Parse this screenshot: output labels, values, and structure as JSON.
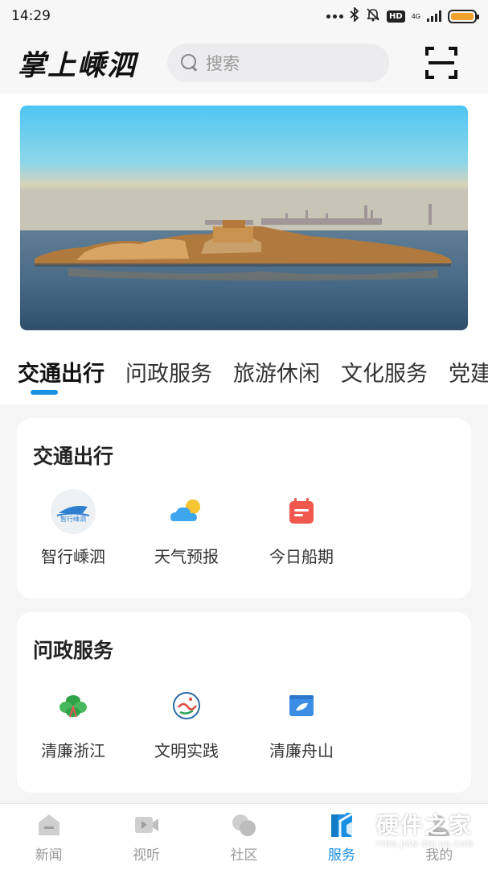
{
  "status_bar": {
    "time": "14:29",
    "hd": "HD",
    "network": "4G"
  },
  "header": {
    "logo": "掌上嵊泗",
    "search_placeholder": "搜索"
  },
  "category_tabs": [
    "交通出行",
    "问政服务",
    "旅游休闲",
    "文化服务",
    "党建"
  ],
  "sections": [
    {
      "title": "交通出行",
      "items": [
        {
          "label": "智行嵊泗",
          "icon": "ship-logo-icon"
        },
        {
          "label": "天气预报",
          "icon": "weather-icon"
        },
        {
          "label": "今日船期",
          "icon": "calendar-icon"
        }
      ]
    },
    {
      "title": "问政服务",
      "items": [
        {
          "label": "清廉浙江",
          "icon": "leaf-emblem-icon"
        },
        {
          "label": "文明实践",
          "icon": "civilization-emblem-icon"
        },
        {
          "label": "清廉舟山",
          "icon": "folder-leaf-icon"
        }
      ]
    }
  ],
  "bottom_nav": [
    {
      "label": "新闻",
      "icon": "news-icon",
      "active": false
    },
    {
      "label": "视听",
      "icon": "video-icon",
      "active": false
    },
    {
      "label": "社区",
      "icon": "community-icon",
      "active": false
    },
    {
      "label": "服务",
      "icon": "service-icon",
      "active": true
    },
    {
      "label": "我的",
      "icon": "profile-icon",
      "active": false
    }
  ],
  "watermark": {
    "main": "硬件之家",
    "sub": "YING JIAN ZHI JIA.COM"
  },
  "colors": {
    "accent": "#1a8fe3",
    "calendar": "#f0584d",
    "weather_cloud": "#3ea6ee",
    "weather_sun": "#f7c531"
  }
}
